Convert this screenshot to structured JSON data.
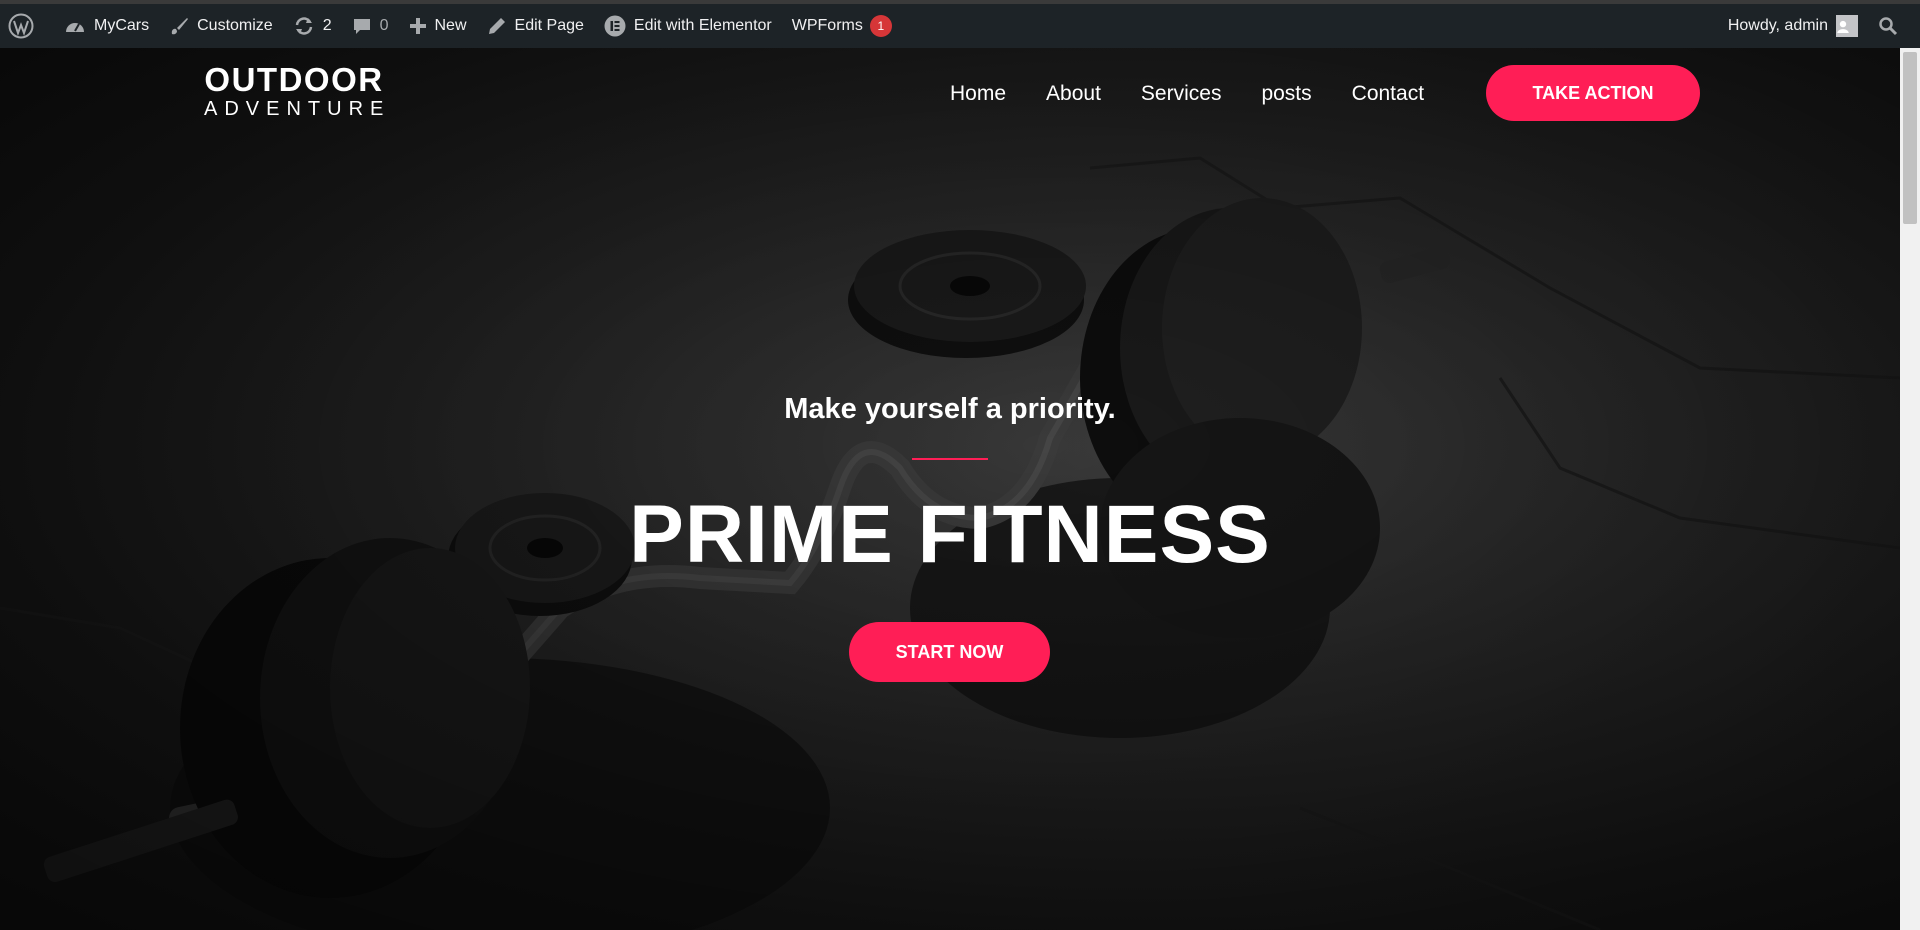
{
  "admin_bar": {
    "site_name": "MyCars",
    "customize": "Customize",
    "updates_count": "2",
    "comments_count": "0",
    "new": "New",
    "edit_page": "Edit Page",
    "edit_elementor": "Edit with Elementor",
    "wpforms": "WPForms",
    "wpforms_badge": "1",
    "howdy": "Howdy, admin"
  },
  "header": {
    "logo_main": "OUTDOOR",
    "logo_sub": "ADVENTURE",
    "nav": [
      "Home",
      "About",
      "Services",
      "posts",
      "Contact"
    ],
    "cta": "TAKE ACTION"
  },
  "hero": {
    "tagline": "Make yourself a priority.",
    "headline": "PRIME FITNESS",
    "cta": "START NOW"
  },
  "colors": {
    "accent": "#ff1e56",
    "admin_bar_bg": "#1d2327",
    "badge": "#d63638"
  }
}
